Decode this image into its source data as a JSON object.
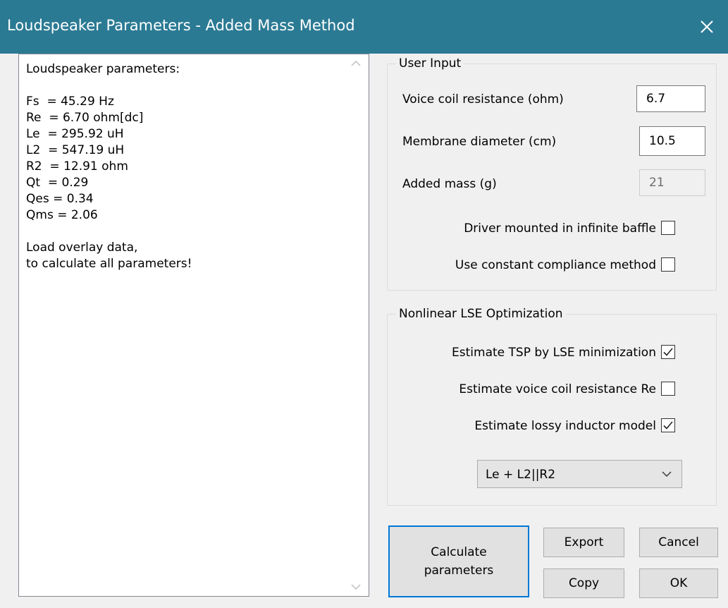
{
  "window": {
    "title": "Loudspeaker Parameters - Added Mass Method"
  },
  "output": {
    "lines": [
      "Loudspeaker parameters:",
      "",
      "Fs  = 45.29 Hz",
      "Re  = 6.70 ohm[dc]",
      "Le  = 295.92 uH",
      "L2  = 547.19 uH",
      "R2  = 12.91 ohm",
      "Qt  = 0.29",
      "Qes = 0.34",
      "Qms = 2.06",
      "",
      "Load overlay data,",
      "to calculate all parameters!"
    ]
  },
  "user_input": {
    "legend": "User Input",
    "voice_coil_label": "Voice coil resistance (ohm)",
    "voice_coil_value": "6.7",
    "diameter_label": "Membrane diameter (cm)",
    "diameter_value": "10.5",
    "added_mass_label": "Added mass (g)",
    "added_mass_value": "21",
    "infinite_baffle_label": "Driver mounted in infinite baffle",
    "infinite_baffle_checked": false,
    "constant_compliance_label": "Use constant compliance method",
    "constant_compliance_checked": false
  },
  "lse": {
    "legend": "Nonlinear LSE Optimization",
    "estimate_tsp_label": "Estimate TSP by LSE minimization",
    "estimate_tsp_checked": true,
    "estimate_re_label": "Estimate voice coil resistance Re",
    "estimate_re_checked": false,
    "estimate_lossy_label": "Estimate lossy inductor model",
    "estimate_lossy_checked": true,
    "model_selected": "Le + L2||R2"
  },
  "buttons": {
    "calculate": "Calculate\nparameters",
    "export": "Export",
    "cancel": "Cancel",
    "copy": "Copy",
    "ok": "OK"
  }
}
